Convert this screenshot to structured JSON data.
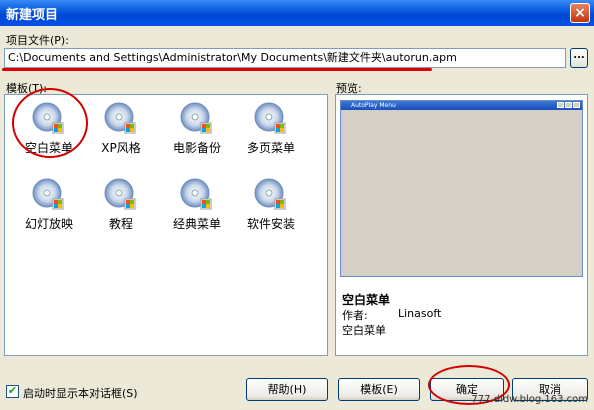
{
  "window": {
    "title": "新建项目",
    "close_label": "×"
  },
  "project_file": {
    "label": "项目文件(P):",
    "value": "C:\\Documents and Settings\\Administrator\\My Documents\\新建文件夹\\autorun.apm",
    "browse_label": "..."
  },
  "templates": {
    "label": "模板(T):",
    "items": [
      {
        "name": "空白菜单",
        "selected": true
      },
      {
        "name": "XP风格"
      },
      {
        "name": "电影备份"
      },
      {
        "name": "多页菜单"
      },
      {
        "name": "幻灯放映"
      },
      {
        "name": "教程"
      },
      {
        "name": "经典菜单"
      },
      {
        "name": "软件安装"
      }
    ]
  },
  "preview": {
    "label": "预览:",
    "mini_window_title": "AutoPlay Menu",
    "template_name": "空白菜单",
    "author_label": "作者:",
    "author": "Linasoft",
    "description": "空白菜单"
  },
  "footer": {
    "show_on_start_label": "启动时显示本对话框(S)",
    "show_on_start_checked": true,
    "help_label": "帮助(H)",
    "template_label": "模板(E)",
    "ok_label": "确定",
    "cancel_label": "取消"
  },
  "watermark": "777.dldw.blog.163.com",
  "colors": {
    "accent": "#0a5ce0",
    "annotation_red": "#d40000"
  },
  "icons": {
    "template": "cd-disc-icon"
  }
}
